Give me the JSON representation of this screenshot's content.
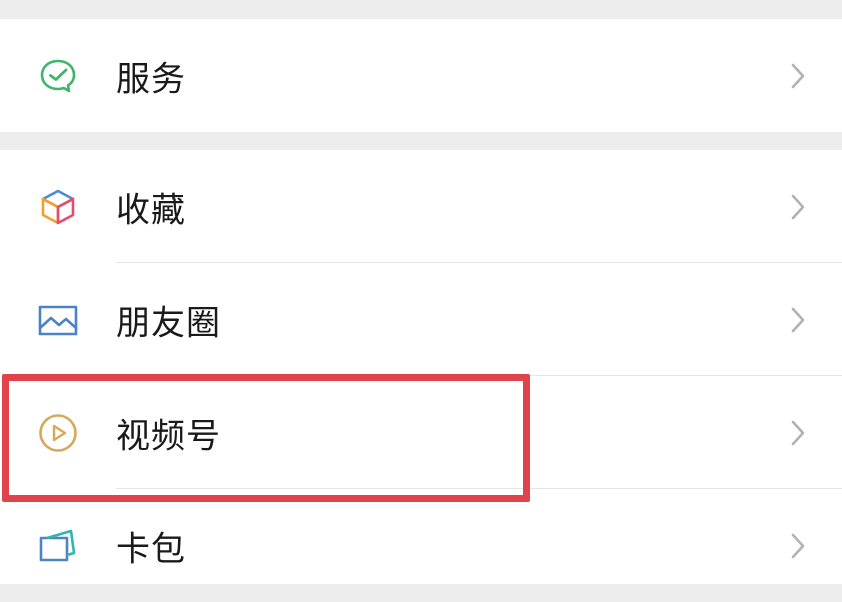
{
  "menu": {
    "group1": [
      {
        "label": "服务",
        "icon": "wechat-pay-service-icon",
        "icon_color": "#3fb56b"
      }
    ],
    "group2": [
      {
        "label": "收藏",
        "icon": "favorites-cube-icon",
        "icon_color": "#f1a02c"
      },
      {
        "label": "朋友圈",
        "icon": "moments-picture-icon",
        "icon_color": "#4b82c8"
      },
      {
        "label": "视频号",
        "icon": "channels-play-icon",
        "icon_color": "#d6a85a"
      },
      {
        "label": "卡包",
        "icon": "card-wallet-icon",
        "icon_color": "#4b86c2"
      }
    ]
  },
  "colors": {
    "background": "#ededed",
    "row_background": "#ffffff",
    "highlight_border": "#e0434b",
    "chevron": "#b2b2b2"
  }
}
